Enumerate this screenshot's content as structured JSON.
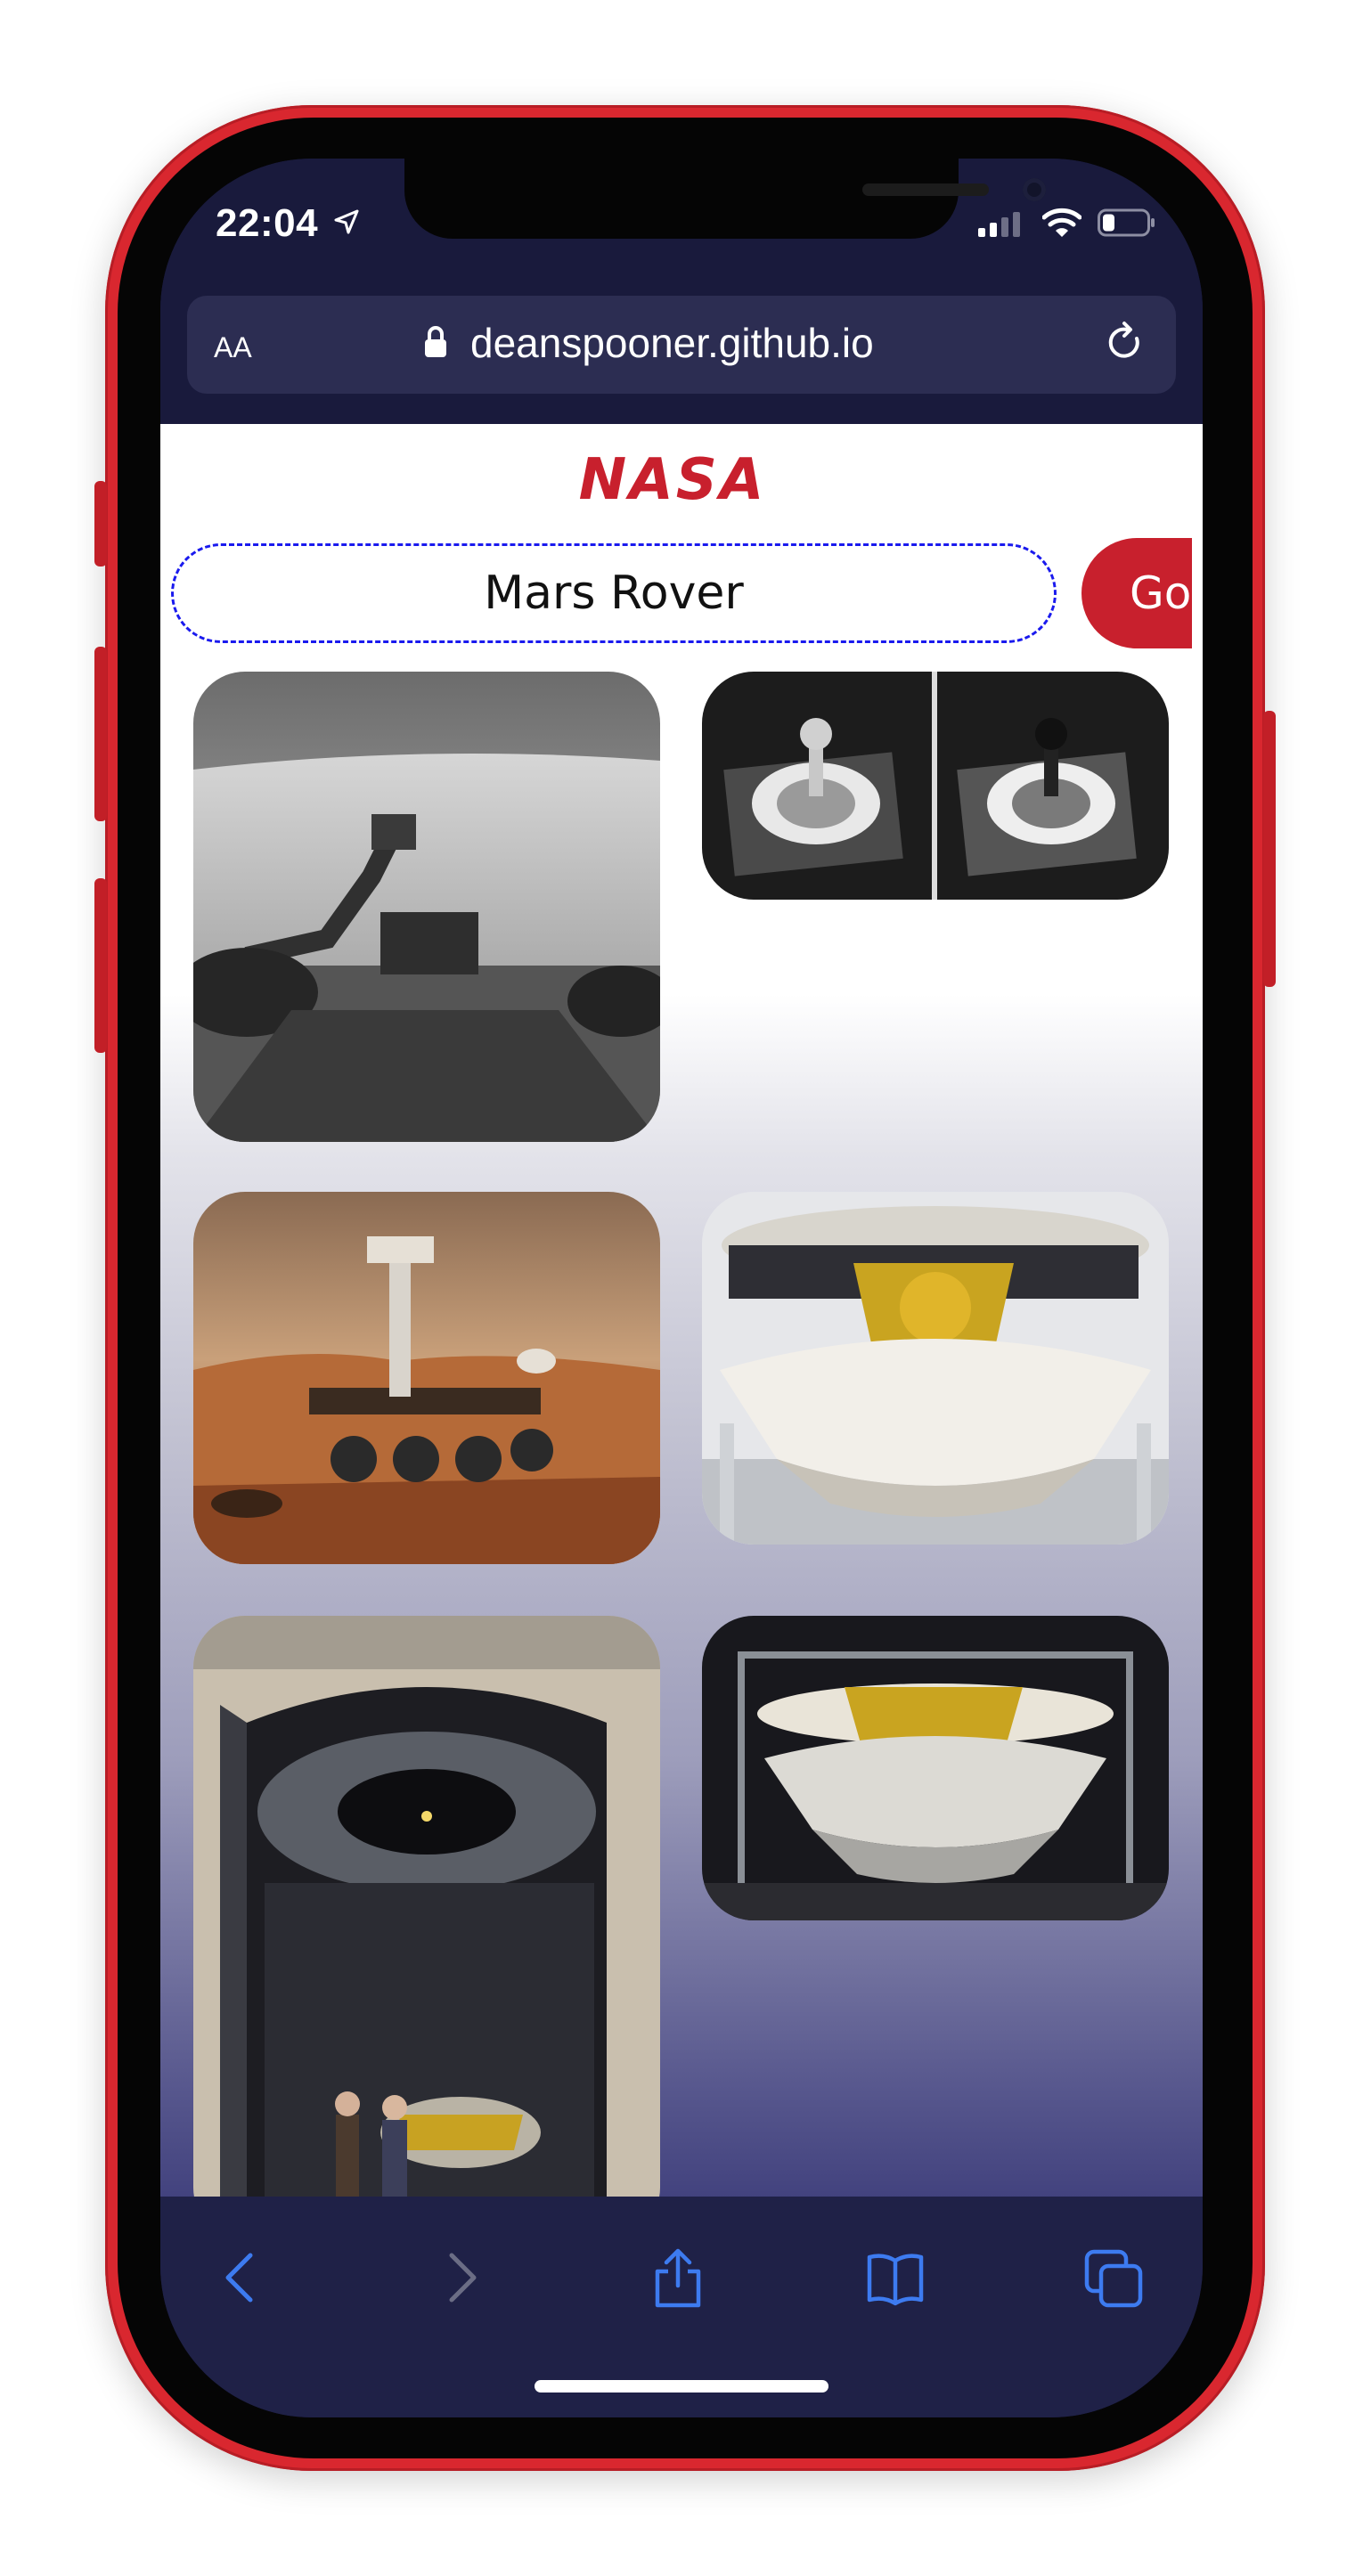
{
  "status_bar": {
    "time": "22:04"
  },
  "browser": {
    "text_size_label": "AA",
    "url": "deanspooner.github.io"
  },
  "page": {
    "logo": "NASA",
    "search": {
      "value": "Mars Rover"
    },
    "go_label": "Go",
    "results": [
      {
        "subject": "black-and-white rover camera view with robotic arm"
      },
      {
        "subject": "side-by-side calibration target images"
      },
      {
        "subject": "Mars rover illustration on martian terrain"
      },
      {
        "subject": "spacecraft lander with gold foil in clean room"
      },
      {
        "subject": "lander inside thermal vacuum chamber with two technicians"
      },
      {
        "subject": "lander assembly inside test frame"
      }
    ]
  },
  "toolbar": {
    "icons": [
      "back-icon",
      "forward-icon",
      "share-icon",
      "bookmarks-icon",
      "tabs-icon"
    ]
  },
  "colors": {
    "phone_frame": "#d9272f",
    "brand_red": "#c8202d",
    "browser_chrome": "#191a3c",
    "toolbar_icon": "#3d7bf0"
  }
}
